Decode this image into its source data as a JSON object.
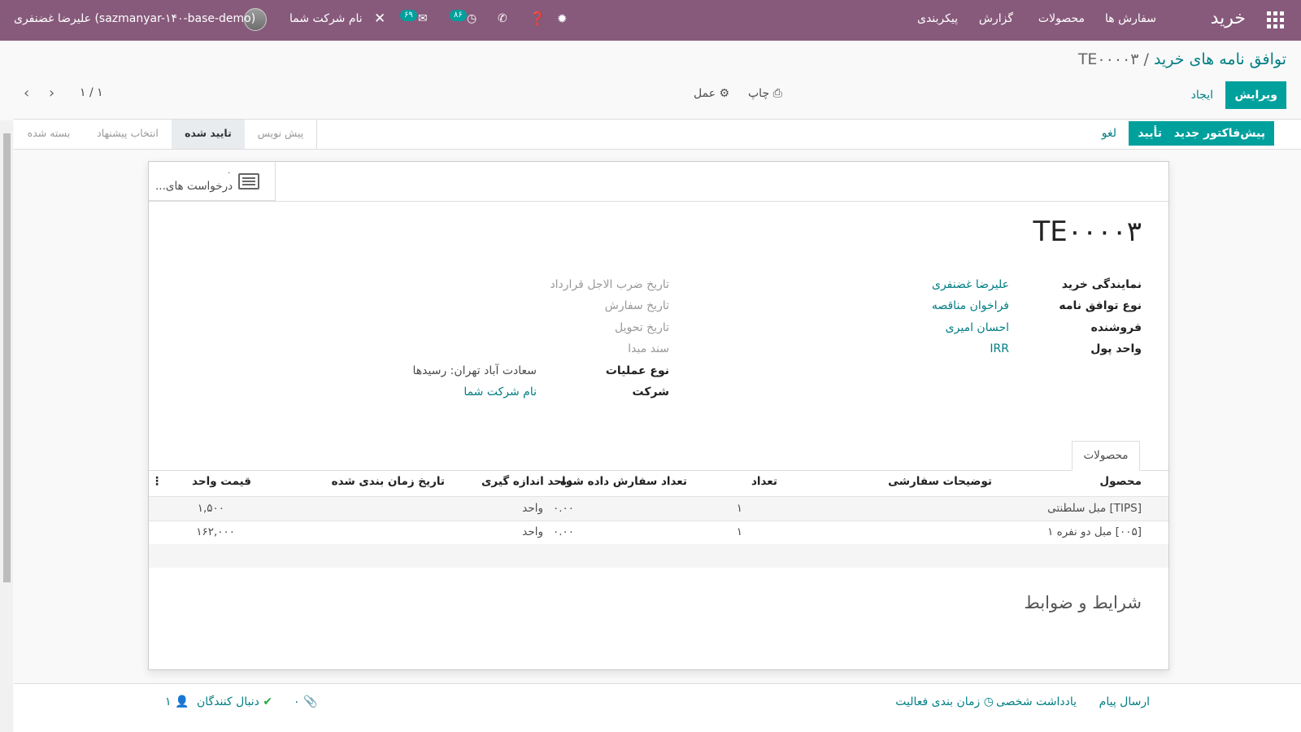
{
  "navbar": {
    "app_name": "خرید",
    "menu": [
      "سفارش ها",
      "محصولات",
      "گزارش",
      "پیکربندی"
    ],
    "company": "نام شرکت شما",
    "user": "علیرضا غضنفری (sazmanyar-۱۴۰-base-demo)",
    "messages_count": "۶۹",
    "activities_count": "۸۶"
  },
  "breadcrumb": {
    "parent": "توافق نامه های خرید",
    "separator": "/",
    "current": "TE۰۰۰۰۳"
  },
  "control": {
    "edit": "ویرایش",
    "create": "ایجاد",
    "print": "چاپ",
    "action": "عمل",
    "pager": "۱ / ۱"
  },
  "status_buttons": {
    "new_quotation": "پیش‌فاکتور جدید",
    "confirm": "تأیید",
    "cancel": "لغو"
  },
  "stages": [
    "پیش نویس",
    "تایید شده",
    "انتخاب پیشنهاد",
    "بسته شده"
  ],
  "active_stage": "تایید شده",
  "smart_button": {
    "count": "۰",
    "label": "درخواست های..."
  },
  "form": {
    "title": "TE۰۰۰۰۳",
    "left_fields": [
      {
        "label": "نمایندگی خرید",
        "value": "علیرضا غضنفری"
      },
      {
        "label": "نوع توافق نامه",
        "value": "فراخوان مناقصه"
      },
      {
        "label": "فروشنده",
        "value": "احسان امیری"
      },
      {
        "label": "واحد پول",
        "value": "IRR"
      }
    ],
    "right_placeholders": [
      "تاریخ ضرب الاجل قرارداد",
      "تاریخ سفارش",
      "تاریخ تحویل",
      "سند مبدا"
    ],
    "right_fields": [
      {
        "label": "نوع عملیات",
        "value": "سعادت آباد تهران: رسیدها"
      },
      {
        "label": "شرکت",
        "value": "نام شرکت شما"
      }
    ]
  },
  "tab": "محصولات",
  "table": {
    "headers": [
      "محصول",
      "توضیحات سفارشی",
      "تعداد",
      "تعداد سفارش داده شده",
      "واحد اندازه گیری",
      "تاریخ زمان بندی شده",
      "قیمت واحد"
    ],
    "rows": [
      [
        "[TIPS] مبل سلطنتی",
        "",
        "۱",
        "۰.۰۰",
        "واحد",
        "",
        "۱,۵۰۰"
      ],
      [
        "[۰۰۵] مبل دو نفره ۱",
        "",
        "۱",
        "۰.۰۰",
        "واحد",
        "",
        "۱۶۲,۰۰۰"
      ]
    ]
  },
  "terms_title": "شرایط و ضوابط",
  "chatter": {
    "send_message": "ارسال پیام",
    "log_note": "یادداشت شخصی",
    "schedule_activity": "زمان بندی فعالیت",
    "attachments_count": "۰",
    "following": "دنبال کنندگان",
    "followers_count": "۱"
  },
  "colors": {
    "navbar": "#875a7b",
    "primary": "#00a09d",
    "link": "#017e84"
  }
}
